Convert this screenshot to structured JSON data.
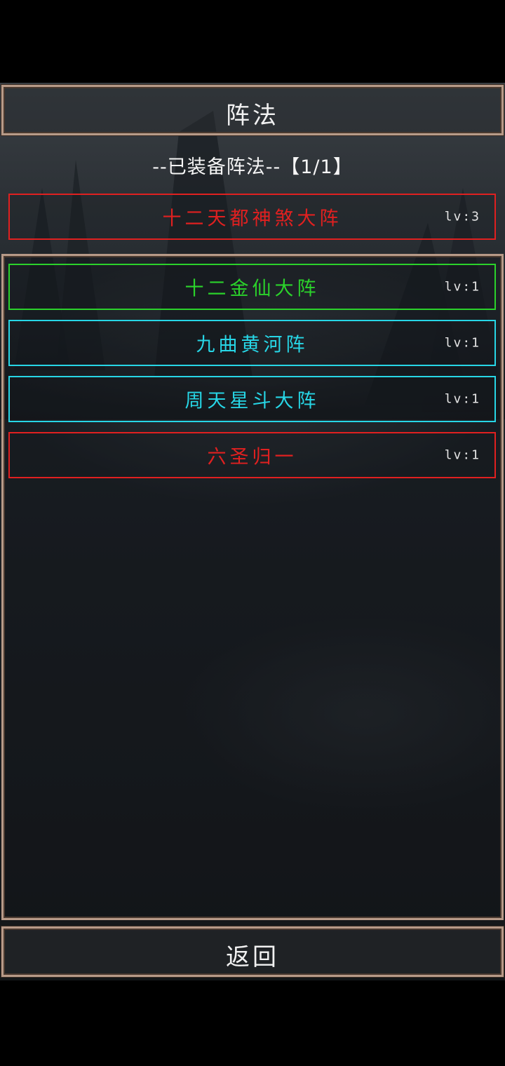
{
  "header": {
    "title": "阵法"
  },
  "equipped": {
    "label": "--已装备阵法--【1/1】",
    "item": {
      "name": "十二天都神煞大阵",
      "level": "lv:3",
      "color": "#e02020"
    }
  },
  "formations": [
    {
      "name": "十二金仙大阵",
      "level": "lv:1",
      "color": "#2bd22b"
    },
    {
      "name": "九曲黄河阵",
      "level": "lv:1",
      "color": "#27d6e6"
    },
    {
      "name": "周天星斗大阵",
      "level": "lv:1",
      "color": "#27d6e6"
    },
    {
      "name": "六圣归一",
      "level": "lv:1",
      "color": "#e02020"
    }
  ],
  "footer": {
    "back_label": "返回"
  },
  "colors": {
    "frame_border": "#b79a88",
    "background": "#1b1f23"
  }
}
